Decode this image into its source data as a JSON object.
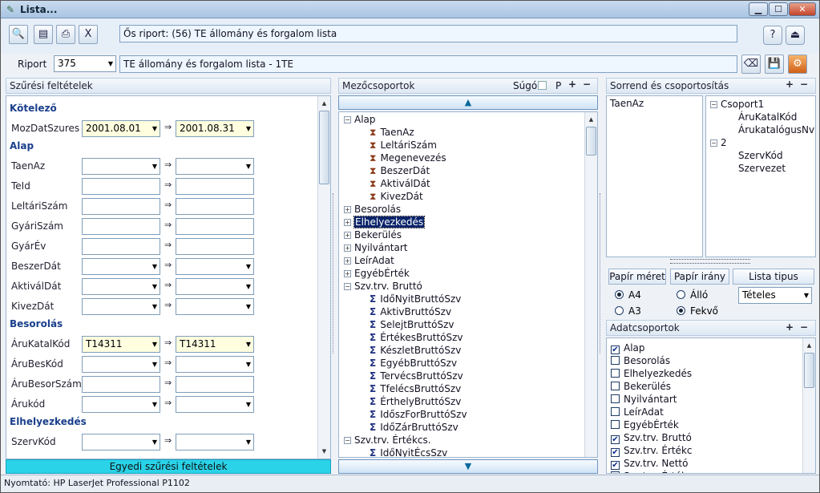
{
  "window": {
    "title": "Lista...",
    "min": "▁",
    "max": "☐",
    "close": "✕"
  },
  "toolbar": {
    "parent_report": "Ős riport: (56)  TE állomány és forgalom lista",
    "report_label": "Riport",
    "report_id": "375",
    "report_name": "TE állomány és forgalom lista - 1TE"
  },
  "filters": {
    "header": "Szűrési feltételek",
    "sections": [
      {
        "title": "Kötelező",
        "fields": [
          {
            "label": "MozDatSzures",
            "from": "2001.08.01",
            "to": "2001.08.31",
            "kind": "combo-yellow"
          }
        ]
      },
      {
        "title": "Alap",
        "fields": [
          {
            "label": "TaenAz",
            "kind": "combo"
          },
          {
            "label": "TeId",
            "kind": "text"
          },
          {
            "label": "LeltáriSzám",
            "kind": "text"
          },
          {
            "label": "GyáriSzám",
            "kind": "text"
          },
          {
            "label": "GyárÉv",
            "kind": "text"
          },
          {
            "label": "BeszerDát",
            "kind": "combo"
          },
          {
            "label": "AktiválDát",
            "kind": "combo"
          },
          {
            "label": "KivezDát",
            "kind": "combo"
          }
        ]
      },
      {
        "title": "Besorolás",
        "fields": [
          {
            "label": "ÁruKatalKód",
            "from": "T14311",
            "to": "T14311",
            "kind": "combo-yellow"
          },
          {
            "label": "ÁruBesKód",
            "kind": "combo"
          },
          {
            "label": "ÁruBesorSzám",
            "kind": "text"
          },
          {
            "label": "Árukód",
            "kind": "combo"
          }
        ]
      },
      {
        "title": "Elhelyezkedés",
        "fields": [
          {
            "label": "SzervKód",
            "kind": "combo"
          }
        ]
      }
    ],
    "custom_button": "Egyedi szűrési feltételek"
  },
  "fieldgroups": {
    "header": "Mezőcsoportok",
    "help_label": "Súgó",
    "p_label": "P",
    "plus": "+",
    "minus": "−",
    "tree": [
      {
        "label": "Alap",
        "level": 0,
        "exp": "−"
      },
      {
        "label": "TaenAz",
        "level": 1,
        "icon": "hour"
      },
      {
        "label": "LeltáriSzám",
        "level": 1,
        "icon": "hour"
      },
      {
        "label": "Megenevezés",
        "level": 1,
        "icon": "hour"
      },
      {
        "label": "BeszerDát",
        "level": 1,
        "icon": "hour"
      },
      {
        "label": "AktiválDát",
        "level": 1,
        "icon": "hour"
      },
      {
        "label": "KivezDát",
        "level": 1,
        "icon": "hour"
      },
      {
        "label": "Besorolás",
        "level": 0,
        "exp": "+"
      },
      {
        "label": "Elhelyezkedés",
        "level": 0,
        "exp": "+",
        "selected": true
      },
      {
        "label": "Bekerülés",
        "level": 0,
        "exp": "+"
      },
      {
        "label": "Nyilvántart",
        "level": 0,
        "exp": "+"
      },
      {
        "label": "LeírAdat",
        "level": 0,
        "exp": "+"
      },
      {
        "label": "EgyébÉrték",
        "level": 0,
        "exp": "+"
      },
      {
        "label": "Szv.trv. Bruttó",
        "level": 0,
        "exp": "−"
      },
      {
        "label": "IdőNyitBruttóSzv",
        "level": 1,
        "icon": "sigma"
      },
      {
        "label": "AktivBruttóSzv",
        "level": 1,
        "icon": "sigma"
      },
      {
        "label": "SelejtBruttóSzv",
        "level": 1,
        "icon": "sigma"
      },
      {
        "label": "ÉrtékesBruttóSzv",
        "level": 1,
        "icon": "sigma"
      },
      {
        "label": "KészletBruttóSzv",
        "level": 1,
        "icon": "sigma"
      },
      {
        "label": "EgyébBruttóSzv",
        "level": 1,
        "icon": "sigma"
      },
      {
        "label": "TervécsBruttóSzv",
        "level": 1,
        "icon": "sigma"
      },
      {
        "label": "TfelécsBruttóSzv",
        "level": 1,
        "icon": "sigma"
      },
      {
        "label": "ÉrthelyBruttóSzv",
        "level": 1,
        "icon": "sigma"
      },
      {
        "label": "IdőszForBruttóSzv",
        "level": 1,
        "icon": "sigma"
      },
      {
        "label": "IdőZárBruttóSzv",
        "level": 1,
        "icon": "sigma"
      },
      {
        "label": "Szv.trv. Értékcs.",
        "level": 0,
        "exp": "−"
      },
      {
        "label": "IdőNyitÉcsSzv",
        "level": 1,
        "icon": "sigma"
      }
    ]
  },
  "order": {
    "header": "Sorrend és csoportosítás",
    "plus": "+",
    "minus": "−",
    "left_items": [
      "TaenAz"
    ],
    "groups": [
      {
        "name": "Csoport1",
        "exp": "−",
        "children": [
          "ÁruKatalKód",
          "ÁrukatalógusNv"
        ]
      },
      {
        "name": "2",
        "exp": "−",
        "children": [
          "SzervKód",
          "Szervezet"
        ]
      }
    ]
  },
  "paper": {
    "size_label": "Papír méret",
    "orient_label": "Papír irány",
    "list_type_label": "Lista tipus",
    "size_options": [
      {
        "label": "A4",
        "on": true
      },
      {
        "label": "A3",
        "on": false
      }
    ],
    "orient_options": [
      {
        "label": "Álló",
        "on": false
      },
      {
        "label": "Fekvő",
        "on": true
      }
    ],
    "list_type_value": "Tételes"
  },
  "datagroups": {
    "header": "Adatcsoportok",
    "plus": "+",
    "minus": "−",
    "items": [
      {
        "label": "Alap",
        "checked": true
      },
      {
        "label": "Besorolás",
        "checked": false
      },
      {
        "label": "Elhelyezkedés",
        "checked": false
      },
      {
        "label": "Bekerülés",
        "checked": false
      },
      {
        "label": "Nyilvántart",
        "checked": false
      },
      {
        "label": "LeírAdat",
        "checked": false
      },
      {
        "label": "EgyébÉrték",
        "checked": false
      },
      {
        "label": "Szv.trv. Bruttó",
        "checked": true
      },
      {
        "label": "Szv.trv. Értékc",
        "checked": true
      },
      {
        "label": "Szv.trv. Nettó",
        "checked": true
      },
      {
        "label": "Szv.trv. Érték",
        "checked": false
      }
    ]
  },
  "statusbar": {
    "printer": "Nyomtató: HP LaserJet Professional P1102"
  },
  "icons": {
    "arrow_right": "⇒",
    "dropdown": "▼",
    "up": "▲",
    "down": "▼",
    "help": "?",
    "exit": "⏏"
  }
}
